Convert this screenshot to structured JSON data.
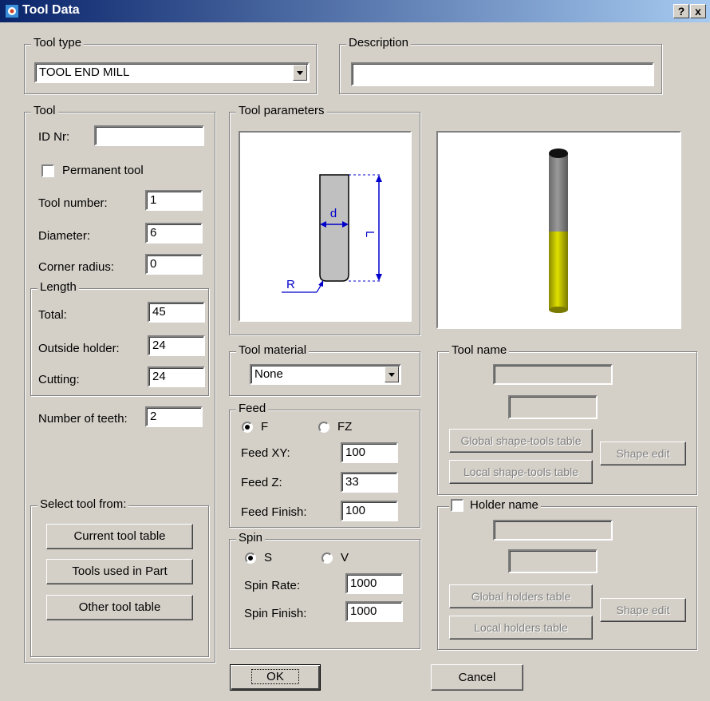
{
  "window": {
    "title": "Tool Data",
    "help_btn": "?",
    "close_btn": "x"
  },
  "tool_type": {
    "legend": "Tool type",
    "value": "TOOL END MILL"
  },
  "description": {
    "legend": "Description",
    "value": ""
  },
  "tool": {
    "legend": "Tool",
    "id_label": "ID Nr:",
    "id_value": "",
    "permanent_label": "Permanent tool",
    "number_label": "Tool number:",
    "number_value": "1",
    "diameter_label": "Diameter:",
    "diameter_value": "6",
    "corner_label": "Corner radius:",
    "corner_value": "0",
    "length": {
      "legend": "Length",
      "total_label": "Total:",
      "total_value": "45",
      "outside_label": "Outside holder:",
      "outside_value": "24",
      "cutting_label": "Cutting:",
      "cutting_value": "24"
    },
    "teeth_label": "Number of teeth:",
    "teeth_value": "2"
  },
  "select_from": {
    "legend": "Select tool from:",
    "current": "Current tool table",
    "used": "Tools used in Part",
    "other": "Other tool table"
  },
  "params": {
    "legend": "Tool parameters",
    "diagram": {
      "d": "d",
      "L": "L",
      "R": "R"
    }
  },
  "material": {
    "legend": "Tool material",
    "value": "None"
  },
  "feed": {
    "legend": "Feed",
    "f": "F",
    "fz": "FZ",
    "selected": "F",
    "xy_label": "Feed XY:",
    "xy_value": "100",
    "z_label": "Feed Z:",
    "z_value": "33",
    "finish_label": "Feed Finish:",
    "finish_value": "100"
  },
  "spin": {
    "legend": "Spin",
    "s": "S",
    "v": "V",
    "selected": "S",
    "rate_label": "Spin Rate:",
    "rate_value": "1000",
    "finish_label": "Spin Finish:",
    "finish_value": "1000"
  },
  "tool_name": {
    "legend": "Tool name",
    "global": "Global shape-tools table",
    "local": "Local shape-tools table",
    "edit": "Shape edit"
  },
  "holder_name": {
    "legend": "Holder name",
    "global": "Global holders table",
    "local": "Local holders table",
    "edit": "Shape edit"
  },
  "actions": {
    "ok": "OK",
    "cancel": "Cancel"
  },
  "colors": {
    "dialog_bg": "#d4d0c8",
    "title_start": "#0a246a",
    "title_end": "#a6caf0",
    "diagram_blue": "#0000cc",
    "tool_shank": "#808080",
    "tool_cutting": "#d8d800"
  }
}
